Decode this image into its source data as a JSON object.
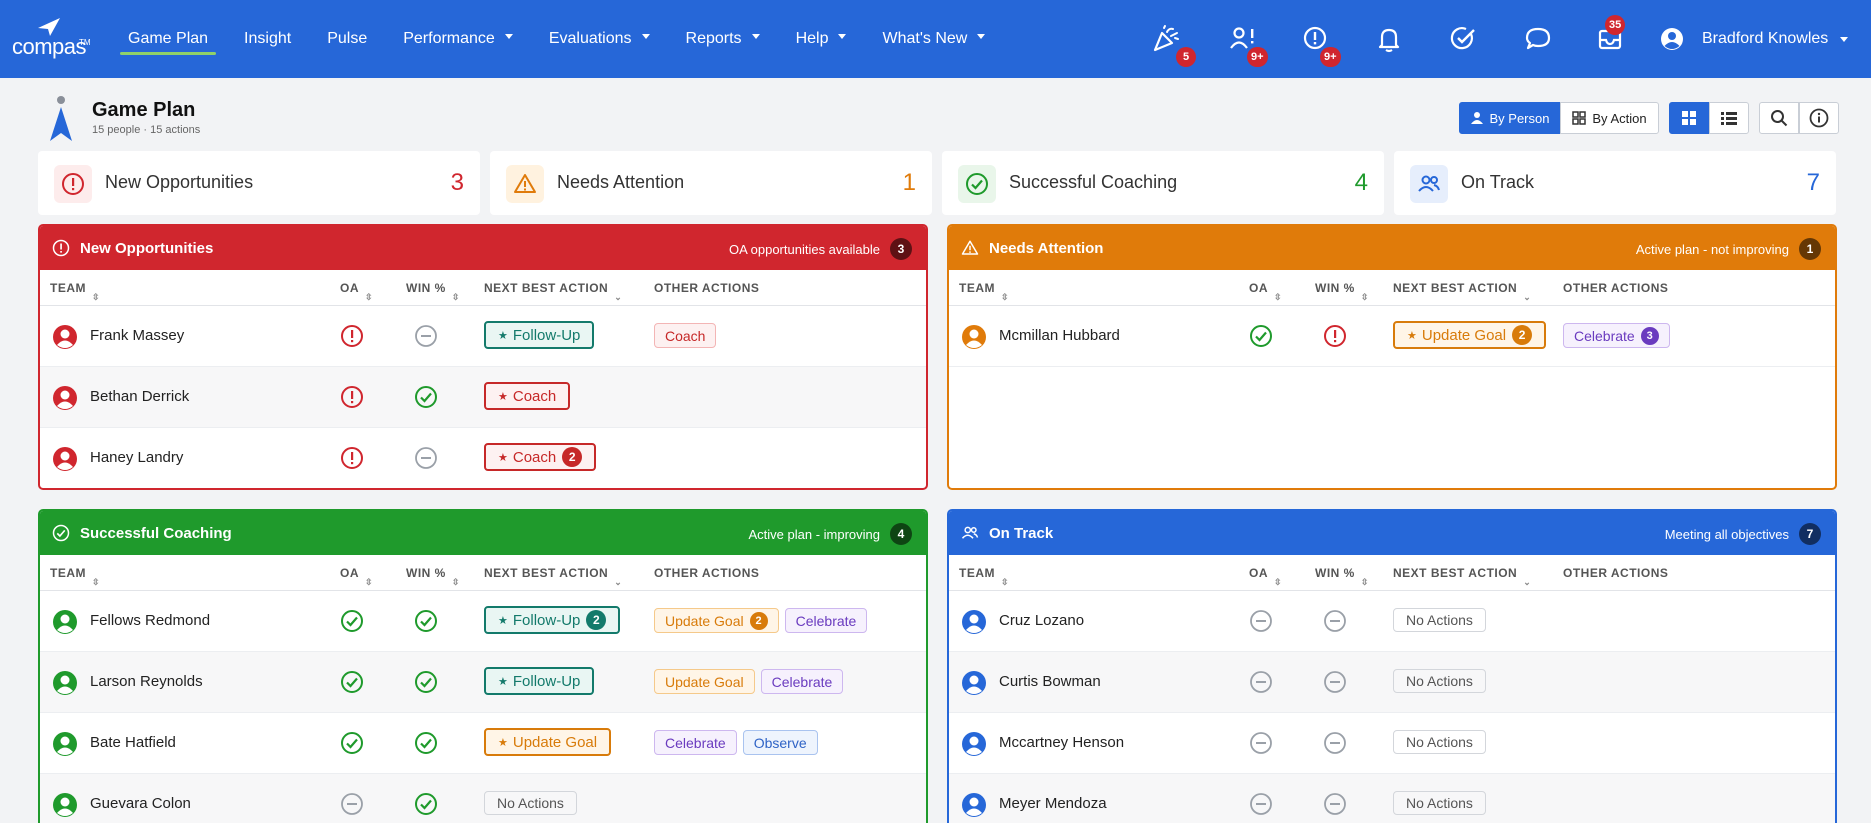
{
  "nav": {
    "logo_text": "compas",
    "logo_tm": "TM",
    "items": [
      {
        "label": "Game Plan",
        "active": true
      },
      {
        "label": "Insight"
      },
      {
        "label": "Pulse"
      },
      {
        "label": "Performance",
        "caret": true
      },
      {
        "label": "Evaluations",
        "caret": true
      },
      {
        "label": "Reports",
        "caret": true
      },
      {
        "label": "Help",
        "caret": true
      },
      {
        "label": "What's New",
        "caret": true
      }
    ],
    "icons": [
      {
        "name": "celebrate-icon",
        "badge": "5"
      },
      {
        "name": "people-alert-icon",
        "badge": "9+"
      },
      {
        "name": "alert-icon",
        "badge": "9+"
      },
      {
        "name": "bell-icon"
      },
      {
        "name": "check-list-icon"
      },
      {
        "name": "chat-icon"
      },
      {
        "name": "inbox-icon",
        "badge": "35"
      }
    ],
    "user_name": "Bradford Knowles"
  },
  "page": {
    "title": "Game Plan",
    "subtitle": "15 people · 15 actions",
    "by_person": "By Person",
    "by_action": "By Action"
  },
  "summary": [
    {
      "label": "New Opportunities",
      "count": "3",
      "color": "#d0262e"
    },
    {
      "label": "Needs Attention",
      "count": "1",
      "color": "#e07b0a"
    },
    {
      "label": "Successful Coaching",
      "count": "4",
      "color": "#1f9a2c"
    },
    {
      "label": "On Track",
      "count": "7",
      "color": "#2667d8"
    }
  ],
  "columns": {
    "team": "TEAM",
    "oa": "OA",
    "win": "WIN %",
    "nba": "NEXT BEST ACTION",
    "other": "OTHER ACTIONS"
  },
  "panels": {
    "new": {
      "title": "New Opportunities",
      "right_text": "OA opportunities available",
      "count": "3",
      "color": "#d0262e",
      "rows": [
        {
          "name": "Frank Massey",
          "oa": "alert",
          "win": "neutral",
          "nba": {
            "label": "Follow-Up",
            "style": "teal"
          },
          "others": [
            {
              "label": "Coach",
              "style": "coach"
            }
          ]
        },
        {
          "name": "Bethan Derrick",
          "oa": "alert",
          "win": "check",
          "nba": {
            "label": "Coach",
            "style": "red"
          },
          "others": []
        },
        {
          "name": "Haney Landry",
          "oa": "alert",
          "win": "neutral",
          "nba": {
            "label": "Coach",
            "style": "red",
            "badge": "2"
          },
          "others": []
        }
      ]
    },
    "attention": {
      "title": "Needs Attention",
      "right_text": "Active plan - not improving",
      "count": "1",
      "color": "#e07b0a",
      "rows": [
        {
          "name": "Mcmillan Hubbard",
          "oa": "check",
          "win": "alert",
          "nba": {
            "label": "Update Goal",
            "style": "orange",
            "badge": "2"
          },
          "others": [
            {
              "label": "Celebrate",
              "style": "cel",
              "badge": "3"
            }
          ]
        }
      ]
    },
    "coaching": {
      "title": "Successful Coaching",
      "right_text": "Active plan - improving",
      "count": "4",
      "color": "#1f9a2c",
      "rows": [
        {
          "name": "Fellows Redmond",
          "oa": "check",
          "win": "check",
          "nba": {
            "label": "Follow-Up",
            "style": "teal",
            "badge": "2"
          },
          "others": [
            {
              "label": "Update Goal",
              "style": "goal",
              "badge": "2"
            },
            {
              "label": "Celebrate",
              "style": "cel"
            }
          ]
        },
        {
          "name": "Larson Reynolds",
          "oa": "check",
          "win": "check",
          "nba": {
            "label": "Follow-Up",
            "style": "teal"
          },
          "others": [
            {
              "label": "Update Goal",
              "style": "goal"
            },
            {
              "label": "Celebrate",
              "style": "cel"
            }
          ]
        },
        {
          "name": "Bate Hatfield",
          "oa": "check",
          "win": "check",
          "nba": {
            "label": "Update Goal",
            "style": "orange"
          },
          "others": [
            {
              "label": "Celebrate",
              "style": "cel"
            },
            {
              "label": "Observe",
              "style": "obs"
            }
          ]
        },
        {
          "name": "Guevara Colon",
          "oa": "neutral",
          "win": "check",
          "nba": {
            "label": "No Actions",
            "style": "none"
          },
          "others": []
        }
      ]
    },
    "ontrack": {
      "title": "On Track",
      "right_text": "Meeting all objectives",
      "count": "7",
      "color": "#2667d8",
      "rows": [
        {
          "name": "Cruz Lozano",
          "oa": "neutral",
          "win": "neutral",
          "nba": {
            "label": "No Actions",
            "style": "none"
          },
          "others": []
        },
        {
          "name": "Curtis Bowman",
          "oa": "neutral",
          "win": "neutral",
          "nba": {
            "label": "No Actions",
            "style": "none"
          },
          "others": []
        },
        {
          "name": "Mccartney Henson",
          "oa": "neutral",
          "win": "neutral",
          "nba": {
            "label": "No Actions",
            "style": "none"
          },
          "others": []
        },
        {
          "name": "Meyer Mendoza",
          "oa": "neutral",
          "win": "neutral",
          "nba": {
            "label": "No Actions",
            "style": "none"
          },
          "others": []
        }
      ]
    }
  }
}
